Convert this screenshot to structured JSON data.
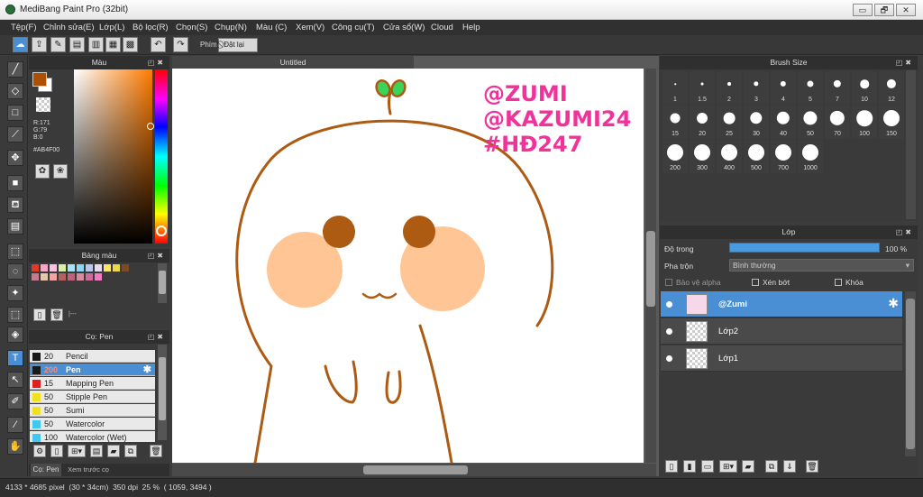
{
  "window": {
    "title": "MediBang Paint Pro (32bit)",
    "controls": [
      "▭",
      "🗗",
      "✕"
    ]
  },
  "menu": [
    "Tệp(F)",
    "Chỉnh sửa(E)",
    "Lớp(L)",
    "Bộ lọc(R)",
    "Chọn(S)",
    "Chụp(N)",
    "Màu (C)",
    "Xem(V)",
    "Công cụ(T)",
    "Cửa sổ(W)",
    "Cloud",
    "Help"
  ],
  "toolbar": {
    "filter_label": "Phím",
    "reset_label": "Đặt lại"
  },
  "color_panel": {
    "title": "Màu",
    "rgb": [
      "R:171",
      "G:79",
      "B:0"
    ],
    "hex": "#AB4F00",
    "foreground": "#AB4F00"
  },
  "palette_panel": {
    "title": "Bảng màu",
    "footer": "|---",
    "colors": [
      "#e23a2a",
      "#f7a6c9",
      "#f9c4e3",
      "#d7f0a8",
      "#a7e3f5",
      "#8fd7f0",
      "#b9c7f2",
      "#e6d9f0",
      "#f7e66b",
      "#f0d64a",
      "#7c4a2a",
      "#c97a8a",
      "#e8c7a8",
      "#f5a3a3",
      "#b86060",
      "#c06080",
      "#d98aa0",
      "#d06a9a",
      "#f27ac2"
    ]
  },
  "brush_panel": {
    "title": "Cọ: Pen",
    "brushes": [
      {
        "size": "20",
        "name": "Pencil",
        "color": "#1a1a1a"
      },
      {
        "size": "200",
        "name": "Pen",
        "color": "#1a1a1a",
        "selected": true
      },
      {
        "size": "15",
        "name": "Mapping Pen",
        "color": "#e02020"
      },
      {
        "size": "50",
        "name": "Stipple Pen",
        "color": "#f0e020"
      },
      {
        "size": "50",
        "name": "Sumi",
        "color": "#f0e020"
      },
      {
        "size": "50",
        "name": "Watercolor",
        "color": "#40c8f0"
      },
      {
        "size": "100",
        "name": "Watercolor (Wet)",
        "color": "#40c8f0"
      }
    ],
    "tabs": [
      "Cọ: Pen",
      "Xem trước cọ"
    ]
  },
  "canvas": {
    "tab": "Untitled",
    "watermark": [
      "@ZUMI",
      "@KAZUMI24",
      "#HĐ247"
    ]
  },
  "brush_size": {
    "title": "Brush Size",
    "sizes": [
      "1",
      "1.5",
      "2",
      "3",
      "4",
      "5",
      "7",
      "10",
      "12",
      "15",
      "20",
      "25",
      "30",
      "40",
      "50",
      "70",
      "100",
      "150",
      "200",
      "300",
      "400",
      "500",
      "700",
      "1000"
    ]
  },
  "layer_panel": {
    "title": "Lớp",
    "opacity_label": "Độ trong",
    "opacity_value": "100 %",
    "blend_label": "Pha trộn",
    "blend_value": "Bình thường",
    "protect_alpha": "Bảo vệ alpha",
    "clipping": "Xén bớt",
    "lock": "Khóa",
    "layers": [
      {
        "name": "@Zumi",
        "selected": true
      },
      {
        "name": "Lớp2"
      },
      {
        "name": "Lớp1"
      }
    ]
  },
  "status": "4133 * 4685 pixel  (30 * 34cm)  350 dpi  25 %  ( 1059, 3494 )"
}
